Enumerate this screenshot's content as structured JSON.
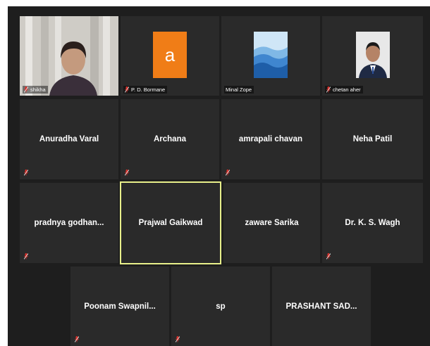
{
  "colors": {
    "background": "#1e1e1e",
    "tile": "#2a2a2a",
    "active_border": "#e8f08a",
    "muted_mic": "#d9302b",
    "avatar_a": "#f07d17"
  },
  "video_tiles": {
    "t1": {
      "name": "shikha"
    },
    "t2": {
      "name": "P. D. Bormane",
      "avatar_letter": "a"
    },
    "t3": {
      "name": "Minal Zope"
    },
    "t4": {
      "name": "chetan aher"
    }
  },
  "participants": [
    {
      "name": "Anuradha Varal"
    },
    {
      "name": "Archana"
    },
    {
      "name": "amrapali chavan"
    },
    {
      "name": "Neha Patil"
    },
    {
      "name": "pradnya  godhan..."
    },
    {
      "name": "Prajwal Gaikwad",
      "active_speaker": true
    },
    {
      "name": "zaware Sarika"
    },
    {
      "name": "Dr. K. S. Wagh"
    },
    {
      "name": "Poonam  Swapnil..."
    },
    {
      "name": "sp"
    },
    {
      "name": "PRASHANT  SAD..."
    }
  ]
}
